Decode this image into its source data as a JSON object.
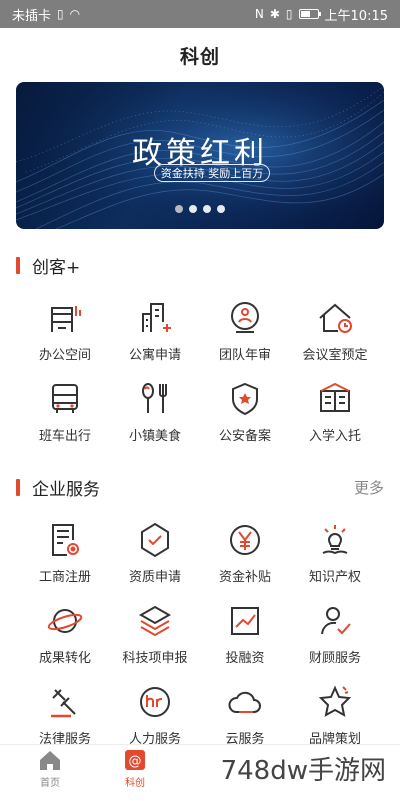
{
  "status_bar": {
    "carrier": "未插卡",
    "time": "上午10:15",
    "battery_level": 0.55
  },
  "header": {
    "title": "科创"
  },
  "banner": {
    "title": "政策红利",
    "subtitle": "资金扶持 奖励上百万",
    "dots": 4,
    "active_dot": 0
  },
  "section1": {
    "title": "创客+",
    "items": [
      {
        "label": "办公空间",
        "icon": "office-space-icon"
      },
      {
        "label": "公寓申请",
        "icon": "apartment-icon"
      },
      {
        "label": "团队年审",
        "icon": "team-review-icon"
      },
      {
        "label": "会议室预定",
        "icon": "meeting-room-icon"
      },
      {
        "label": "班车出行",
        "icon": "shuttle-bus-icon"
      },
      {
        "label": "小镇美食",
        "icon": "food-icon"
      },
      {
        "label": "公安备案",
        "icon": "police-record-icon"
      },
      {
        "label": "入学入托",
        "icon": "school-icon"
      }
    ]
  },
  "section2": {
    "title": "企业服务",
    "more": "更多",
    "items": [
      {
        "label": "工商注册",
        "icon": "business-registration-icon"
      },
      {
        "label": "资质申请",
        "icon": "qualification-icon"
      },
      {
        "label": "资金补贴",
        "icon": "subsidy-icon"
      },
      {
        "label": "知识产权",
        "icon": "ip-icon"
      },
      {
        "label": "成果转化",
        "icon": "planet-icon"
      },
      {
        "label": "科技项申报",
        "icon": "layers-icon"
      },
      {
        "label": "投融资",
        "icon": "investment-icon"
      },
      {
        "label": "财顾服务",
        "icon": "advisor-icon"
      },
      {
        "label": "法律服务",
        "icon": "gavel-icon"
      },
      {
        "label": "人力服务",
        "icon": "hr-icon"
      },
      {
        "label": "云服务",
        "icon": "cloud-icon"
      },
      {
        "label": "品牌策划",
        "icon": "brand-star-icon"
      }
    ]
  },
  "tabbar": {
    "tabs": [
      {
        "label": "首页",
        "icon": "home-icon",
        "active": false
      },
      {
        "label": "科创",
        "icon": "kechuang-icon",
        "active": true
      }
    ]
  },
  "watermark": "748dw手游网",
  "colors": {
    "accent": "#e2492f",
    "icon_dark": "#333333",
    "status_bar": "#7e7e7e"
  }
}
